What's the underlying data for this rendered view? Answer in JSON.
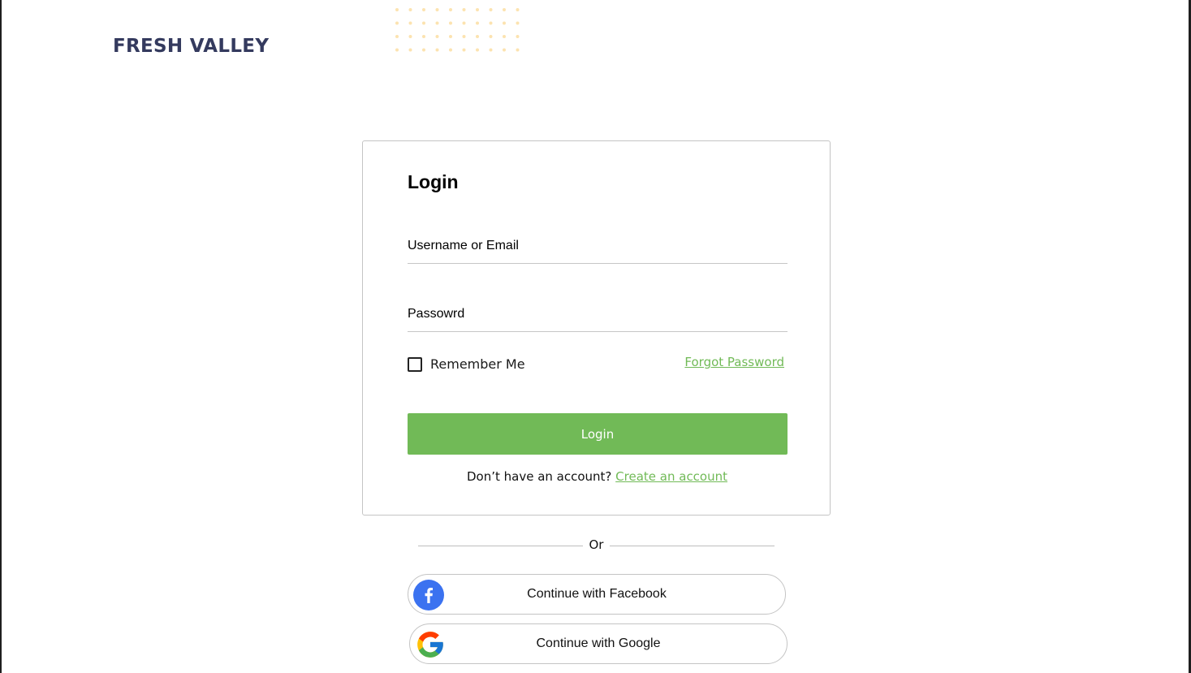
{
  "brand": {
    "name": "FRESH VALLEY"
  },
  "login_form": {
    "title": "Login",
    "username_placeholder": "Username or Email",
    "password_placeholder": "Passowrd",
    "remember_label": "Remember Me",
    "remember_checked": false,
    "forgot_label": "Forgot Password",
    "submit_label": "Login",
    "signup_prompt": "Don’t have an account?",
    "signup_link": "Create an account"
  },
  "divider": {
    "text": "Or"
  },
  "social": [
    {
      "label": "Continue with Facebook",
      "icon": "facebook-icon"
    },
    {
      "label": "Continue with Google",
      "icon": "google-icon"
    }
  ],
  "colors": {
    "brand_text": "#343a5e",
    "accent_green": "#71ba57",
    "facebook_blue": "#3b72f0",
    "dots": "#fce3b0"
  }
}
